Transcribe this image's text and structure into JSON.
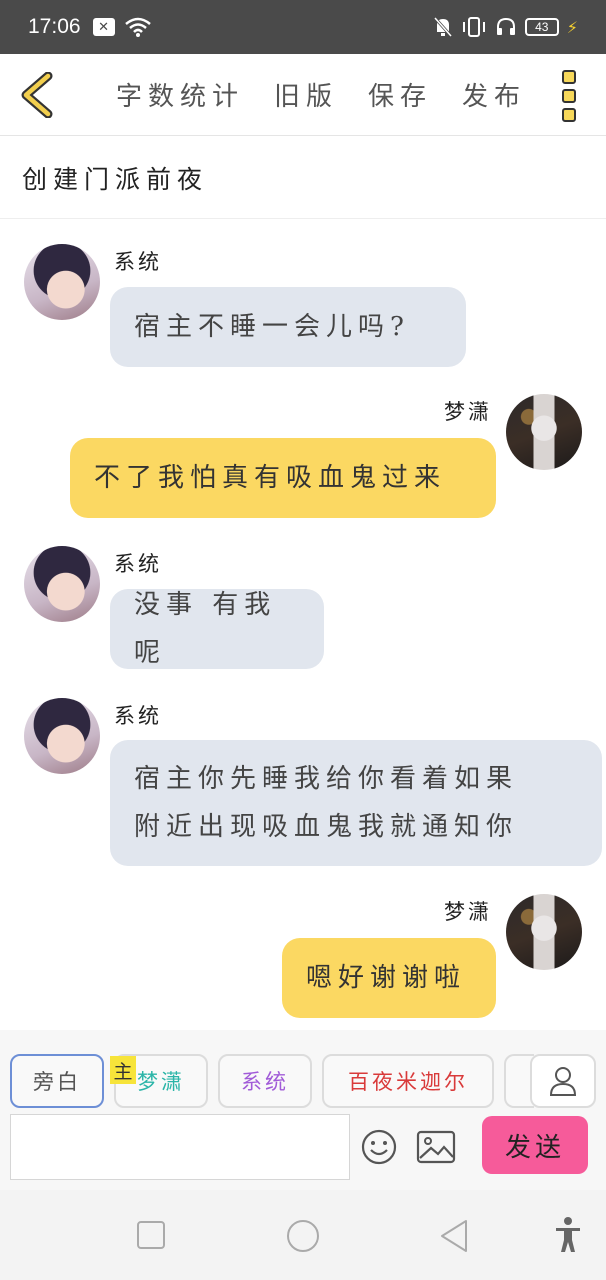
{
  "status_bar": {
    "time": "17:06",
    "battery": "43"
  },
  "toolbar": {
    "actions": [
      "字数统计",
      "旧版",
      "保存",
      "发布"
    ]
  },
  "chapter": {
    "title": "创建门派前夜"
  },
  "messages": [
    {
      "role": "system",
      "sender": "系统",
      "lines": [
        "宿主不睡一会儿吗?"
      ]
    },
    {
      "role": "user",
      "sender": "梦潇",
      "lines": [
        "不了我怕真有吸血鬼过来"
      ]
    },
    {
      "role": "system",
      "sender": "系统",
      "lines": [
        "没事 有我呢"
      ]
    },
    {
      "role": "system",
      "sender": "系统",
      "lines": [
        "宿主你先睡我给你看着如果",
        "附近出现吸血鬼我就通知你"
      ]
    },
    {
      "role": "user",
      "sender": "梦潇",
      "lines": [
        "嗯好谢谢啦"
      ]
    }
  ],
  "roles": [
    {
      "label": "旁白",
      "color": "#555555"
    },
    {
      "label": "梦潇",
      "color": "#2bb5a8"
    },
    {
      "label": "系统",
      "color": "#a15bd8"
    },
    {
      "label": "百夜米迦尔",
      "color": "#d93a3a"
    }
  ],
  "main_badge": "主",
  "input": {
    "value": "",
    "placeholder": ""
  },
  "send_label": "发送",
  "colors": {
    "bubble_system": "#e1e6ee",
    "bubble_user": "#fbd862",
    "send_button": "#f65b9a",
    "accent_yellow": "#f7d85a"
  }
}
